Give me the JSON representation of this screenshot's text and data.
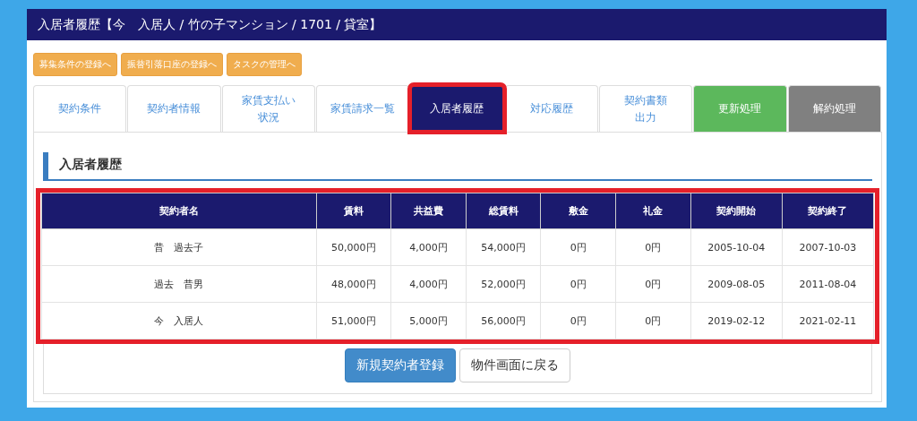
{
  "header": {
    "title": "入居者履歴【今　入居人 / 竹の子マンション / 1701 / 貸室】"
  },
  "action_buttons": [
    "募集条件の登録へ",
    "振替引落口座の登録へ",
    "タスクの管理へ"
  ],
  "tabs": [
    {
      "label": "契約条件",
      "kind": "normal",
      "selected": false
    },
    {
      "label": "契約者情報",
      "kind": "normal",
      "selected": false
    },
    {
      "label": "家賃支払い状況",
      "kind": "normal",
      "selected": false
    },
    {
      "label": "家賃請求一覧",
      "kind": "normal",
      "selected": false
    },
    {
      "label": "入居者履歴",
      "kind": "normal",
      "selected": true,
      "highlighted": true
    },
    {
      "label": "対応履歴",
      "kind": "normal",
      "selected": false
    },
    {
      "label": "契約書類出力",
      "kind": "normal",
      "selected": false
    },
    {
      "label": "更新処理",
      "kind": "renew",
      "selected": false
    },
    {
      "label": "解約処理",
      "kind": "cancel",
      "selected": false
    }
  ],
  "section": {
    "title": "入居者履歴"
  },
  "table": {
    "highlighted": true,
    "columns": [
      "契約者名",
      "賃料",
      "共益費",
      "総賃料",
      "敷金",
      "礼金",
      "契約開始",
      "契約終了"
    ],
    "rows": [
      [
        "昔　過去子",
        "50,000円",
        "4,000円",
        "54,000円",
        "0円",
        "0円",
        "2005-10-04",
        "2007-10-03"
      ],
      [
        "過去　昔男",
        "48,000円",
        "4,000円",
        "52,000円",
        "0円",
        "0円",
        "2009-08-05",
        "2011-08-04"
      ],
      [
        "今　入居人",
        "51,000円",
        "5,000円",
        "56,000円",
        "0円",
        "0円",
        "2019-02-12",
        "2021-02-11"
      ]
    ]
  },
  "footer_buttons": [
    {
      "label": "新規契約者登録",
      "kind": "primary"
    },
    {
      "label": "物件画面に戻る",
      "kind": "default"
    }
  ]
}
